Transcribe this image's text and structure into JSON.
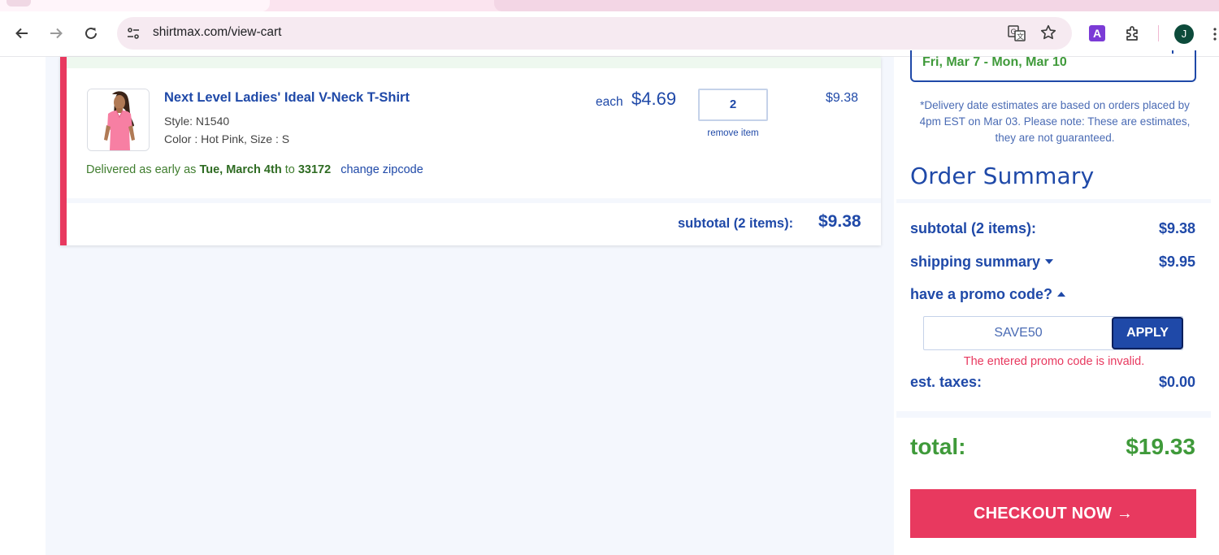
{
  "browser": {
    "url": "shirtmax.com/view-cart",
    "profile_initial": "J",
    "extension_letter": "A"
  },
  "cart": {
    "item": {
      "name": "Next Level Ladies' Ideal V-Neck T-Shirt",
      "style": "Style: N1540",
      "color": "Color : Hot Pink, Size : S",
      "each_label": "each",
      "each_price": "$4.69",
      "quantity": "2",
      "remove_label": "remove item",
      "line_total": "$9.38",
      "delivery_prefix": "Delivered as early as",
      "delivery_date": "Tue, March 4th",
      "delivery_to": "to",
      "delivery_zip": "33172",
      "change_zip_label": "change zipcode"
    },
    "subtotal_label": "subtotal (2 items):",
    "subtotal_value": "$9.38"
  },
  "summary": {
    "delivery_range": "Fri, Mar 7 - Mon, Mar 10",
    "disclaimer": "*Delivery date estimates are based on orders placed by 4pm EST on Mar 03. Please note: These are estimates, they are not guaranteed.",
    "title": "Order Summary",
    "subtotal_label": "subtotal (2 items):",
    "subtotal_value": "$9.38",
    "shipping_label": "shipping summary",
    "shipping_value": "$9.95",
    "promo_label": "have a promo code?",
    "promo_value": "SAVE50",
    "apply_label": "APPLY",
    "promo_error": "The entered promo code is invalid.",
    "taxes_label": "est. taxes:",
    "taxes_value": "$0.00",
    "total_label": "total:",
    "total_value": "$19.33",
    "checkout_label": "CHECKOUT NOW →"
  },
  "colors": {
    "brand_blue": "#1f49a8",
    "accent_pink": "#e8395f",
    "total_green": "#3f9a3a"
  },
  "icons": [
    "back-arrow-icon",
    "forward-arrow-icon",
    "reload-icon",
    "site-info-icon",
    "translate-icon",
    "star-icon",
    "puzzle-icon",
    "more-icon"
  ]
}
